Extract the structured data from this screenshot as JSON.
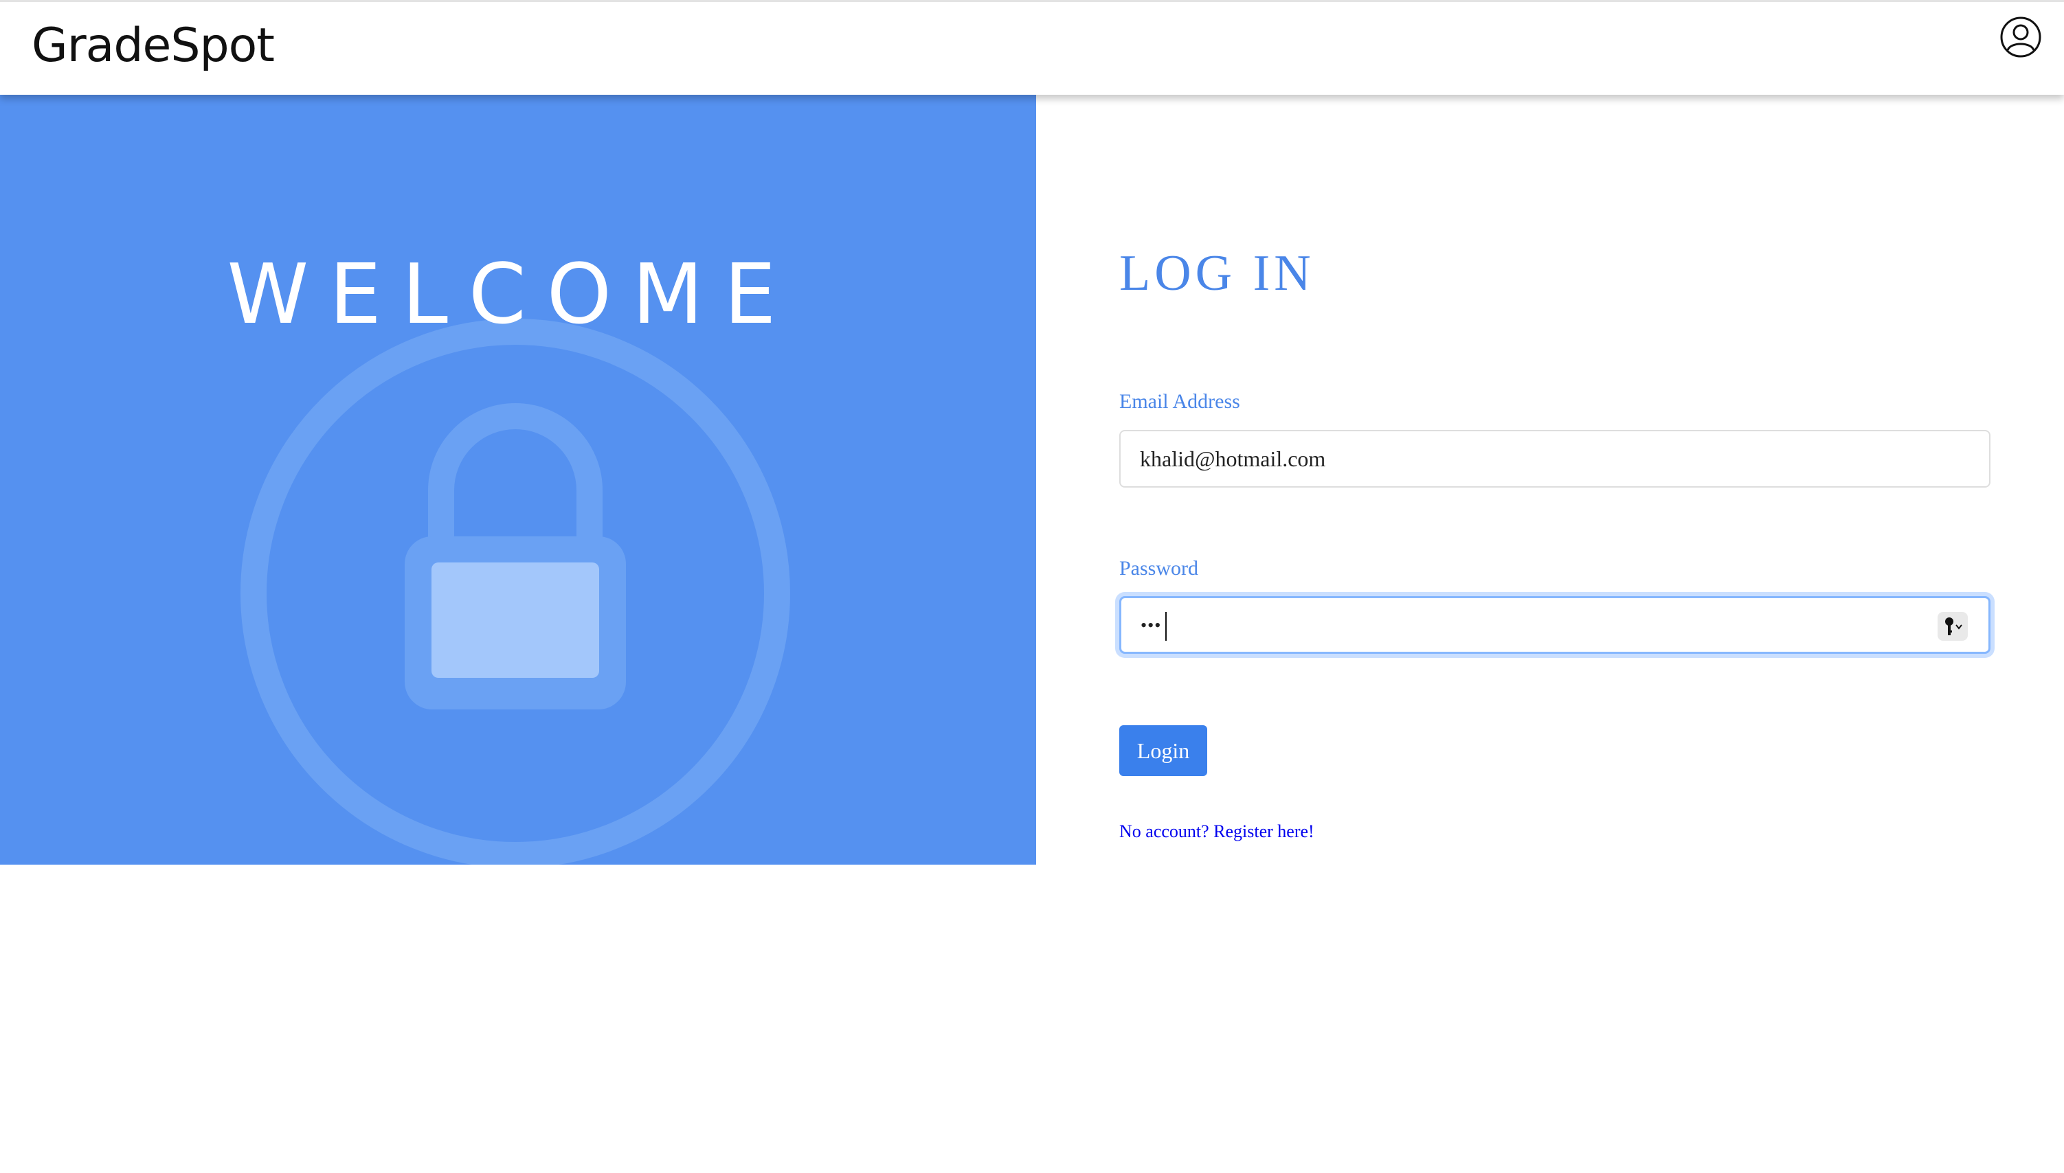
{
  "header": {
    "brand": "GradeSpot",
    "user_icon": "user-circle-icon"
  },
  "hero": {
    "welcome_text": "WELCOME",
    "illustration_icon": "lock-icon"
  },
  "login_form": {
    "title": "LOG IN",
    "email_label": "Email Address",
    "email_value": "khalid@hotmail.com",
    "password_label": "Password",
    "password_masked": "•••",
    "password_manager_icon": "key-icon",
    "submit_label": "Login",
    "register_link": "No account? Register here!"
  },
  "colors": {
    "panel_blue": "#5591f0",
    "accent_blue": "#4a86e8",
    "button_blue": "#3a80ec",
    "link_blue": "#0000ee"
  }
}
